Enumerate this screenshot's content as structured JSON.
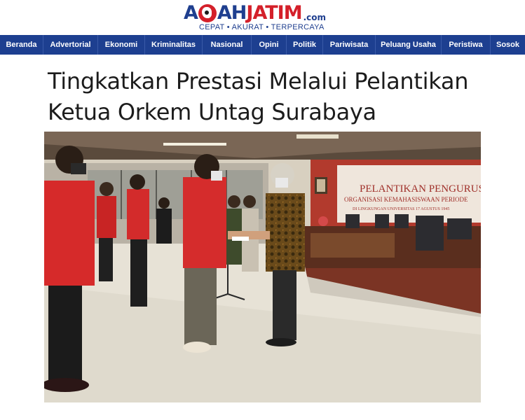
{
  "site": {
    "logo_part1": "A",
    "logo_part2": "AH",
    "logo_part3": "JATIM",
    "logo_suffix": ".com",
    "tagline": "CEPAT • AKURAT • TERPERCAYA",
    "brand_blue": "#1d3f90",
    "brand_red": "#d4202a"
  },
  "nav": {
    "items": [
      {
        "label": "Beranda"
      },
      {
        "label": "Advertorial"
      },
      {
        "label": "Ekonomi"
      },
      {
        "label": "Kriminalitas"
      },
      {
        "label": "Nasional"
      },
      {
        "label": "Opini"
      },
      {
        "label": "Politik"
      },
      {
        "label": "Pariwisata"
      },
      {
        "label": "Peluang Usaha"
      },
      {
        "label": "Peristiwa"
      },
      {
        "label": "Sosok"
      }
    ]
  },
  "article": {
    "title": "Tingkatkan Prestasi Melalui Pelantikan Ketua Orkem Untag Surabaya",
    "image": {
      "banner_line1": "PELANTIKAN PENGURUS",
      "banner_line2": "ORGANISASI KEMAHASISWAAN PERIODE",
      "banner_line3": "DI LINGKUNGAN UNIVERSITAS 17 AGUSTUS 1945"
    }
  }
}
